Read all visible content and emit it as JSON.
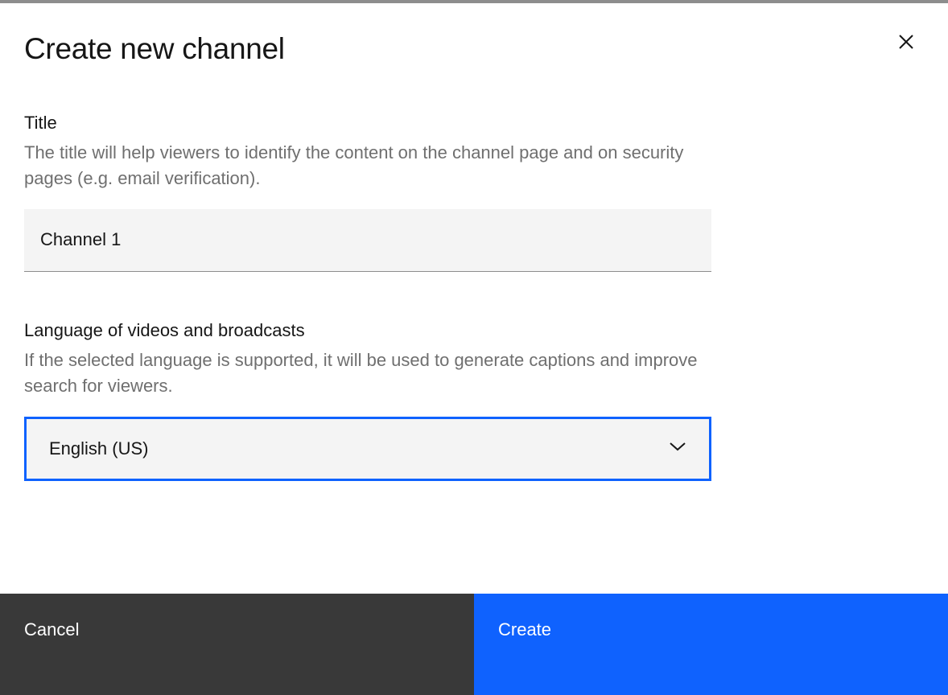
{
  "modal": {
    "title": "Create new channel",
    "fields": {
      "title": {
        "label": "Title",
        "help": "The title will help viewers to identify the content on the channel page and on security pages (e.g. email verification).",
        "value": "Channel 1"
      },
      "language": {
        "label": "Language of videos and broadcasts",
        "help": "If the selected language is supported, it will be used to generate captions and improve search for viewers.",
        "selected": "English (US)"
      }
    },
    "buttons": {
      "cancel": "Cancel",
      "create": "Create"
    }
  }
}
